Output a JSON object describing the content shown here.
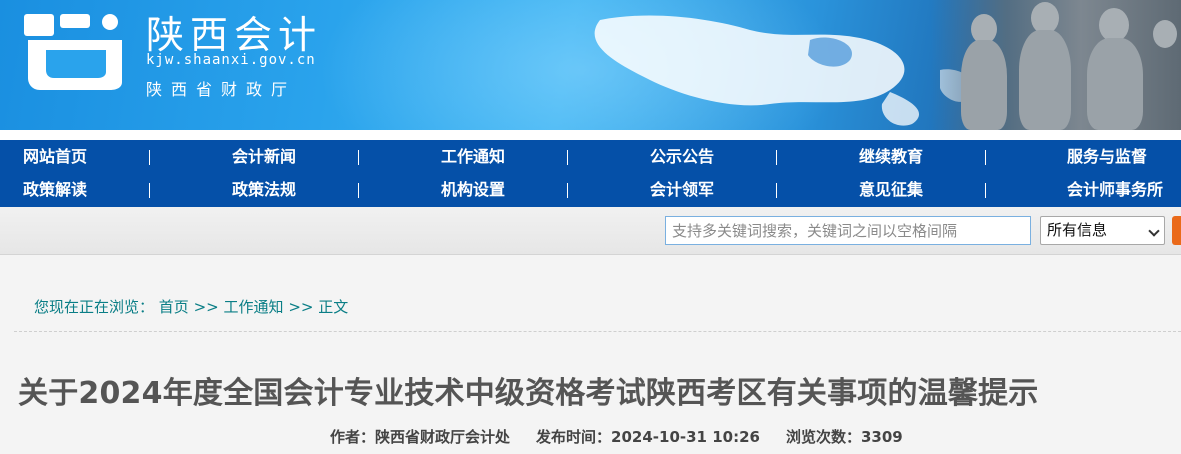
{
  "header": {
    "site_name": "陕西会计",
    "domain": "kjw.shaanxi.gov.cn",
    "organization": "陕西省财政厅",
    "colors": {
      "banner": "#2aa3ec",
      "nav": "#0550a8",
      "breadcrumb": "#0a7e86",
      "search_button": "#ea6a1a"
    }
  },
  "nav": {
    "row1": [
      {
        "label": "网站首页"
      },
      {
        "label": "会计新闻"
      },
      {
        "label": "工作通知"
      },
      {
        "label": "公示公告"
      },
      {
        "label": "继续教育"
      },
      {
        "label": "服务与监督"
      }
    ],
    "row2": [
      {
        "label": "政策解读"
      },
      {
        "label": "政策法规"
      },
      {
        "label": "机构设置"
      },
      {
        "label": "会计领军"
      },
      {
        "label": "意见征集"
      },
      {
        "label": "会计师事务所"
      }
    ]
  },
  "search": {
    "placeholder": "支持多关键词搜索，关键词之间以空格间隔",
    "scope_selected": "所有信息",
    "button_icon": "search-icon"
  },
  "breadcrumb": {
    "prefix": "您现在正在浏览：",
    "home": "首页",
    "sep1": ">>",
    "section": "工作通知",
    "sep2": ">>",
    "current": "正文"
  },
  "article": {
    "title": "关于2024年度全国会计专业技术中级资格考试陕西考区有关事项的温馨提示",
    "author_label": "作者：",
    "author": "陕西省财政厅会计处",
    "published_label": "发布时间：",
    "published": "2024-10-31 10:26",
    "views_label": "浏览次数：",
    "views": "3309"
  }
}
